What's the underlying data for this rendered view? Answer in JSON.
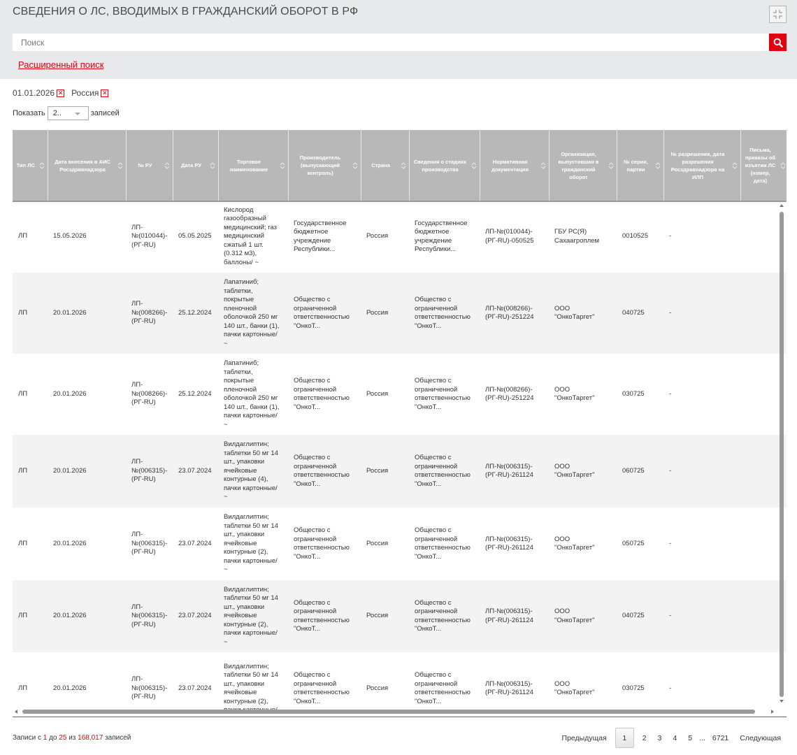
{
  "page": {
    "title": "СВЕДЕНИЯ О ЛС, ВВОДИМЫХ В ГРАЖДАНСКИЙ ОБОРОТ В РФ"
  },
  "search": {
    "placeholder": "Поиск",
    "advanced_label": "Расширенный поиск"
  },
  "filters": [
    {
      "label": "01.01.2026"
    },
    {
      "label": "Россия"
    }
  ],
  "length": {
    "prefix": "Показать",
    "value": "2..",
    "suffix": "записей"
  },
  "colors": {
    "accent": "#e3000f",
    "header_bg": "#b8b8b8"
  },
  "table": {
    "columns": [
      "Тип ЛС",
      "Дата внесения в АИС Росздравнадзора",
      "№ РУ",
      "Дата РУ",
      "Торговое наименование",
      "Производитель (выпускающий контроль)",
      "Страна",
      "Сведения о стадиях производства",
      "Нормативная документация",
      "Организация, выпустившая в гражданский оборот",
      "№ серии, партии",
      "№ разрешения, дата разрешения Росздравнадзора на ИЛП",
      "Письма, приказы об изъятии ЛС (номер, дата)"
    ],
    "rows": [
      [
        "ЛП",
        "15.05.2026",
        "ЛП-№(010044)-(РГ-RU)",
        "05.05.2025",
        "Кислород газообразный медицинский; газ медицинский сжатый 1 шт. (0.312 м3), баллоны/ ~",
        "Государственное бюджетное учреждение Республики...",
        "Россия",
        "Государственное бюджетное учреждение Республики...",
        "ЛП-№(010044)-(РГ-RU)-050525",
        "ГБУ РС(Я) Сахаагроплем",
        "0010525",
        "-",
        ""
      ],
      [
        "ЛП",
        "20.01.2026",
        "ЛП-№(008266)-(РГ-RU)",
        "25.12.2024",
        "Лапатиниб; таблетки, покрытые пленочной оболочкой 250 мг 140 шт., банки (1), пачки картонные/ ~",
        "Общество с ограниченной ответственностью \"ОнкоТ...",
        "Россия",
        "Общество с ограниченной ответственностью \"ОнкоТ...",
        "ЛП-№(008266)-(РГ-RU)-251224",
        "ООО \"ОнкоТаргет\"",
        "040725",
        "-",
        ""
      ],
      [
        "ЛП",
        "20.01.2026",
        "ЛП-№(008266)-(РГ-RU)",
        "25.12.2024",
        "Лапатиниб; таблетки, покрытые пленочной оболочкой 250 мг 140 шт., банки (1), пачки картонные/ ~",
        "Общество с ограниченной ответственностью \"ОнкоТ...",
        "Россия",
        "Общество с ограниченной ответственностью \"ОнкоТ...",
        "ЛП-№(008266)-(РГ-RU)-251224",
        "ООО \"ОнкоТаргет\"",
        "030725",
        "-",
        ""
      ],
      [
        "ЛП",
        "20.01.2026",
        "ЛП-№(006315)-(РГ-RU)",
        "23.07.2024",
        "Вилдаглиптин; таблетки 50 мг 14 шт., упаковки ячейковые контурные (4), пачки картонные/ ~",
        "Общество с ограниченной ответственностью \"ОнкоТ...",
        "Россия",
        "Общество с ограниченной ответственностью \"ОнкоТ...",
        "ЛП-№(006315)-(РГ-RU)-261124",
        "ООО \"ОнкоТаргет\"",
        "060725",
        "-",
        ""
      ],
      [
        "ЛП",
        "20.01.2026",
        "ЛП-№(006315)-(РГ-RU)",
        "23.07.2024",
        "Вилдаглиптин; таблетки 50 мг 14 шт., упаковки ячейковые контурные (2), пачки картонные/ ~",
        "Общество с ограниченной ответственностью \"ОнкоТ...",
        "Россия",
        "Общество с ограниченной ответственностью \"ОнкоТ...",
        "ЛП-№(006315)-(РГ-RU)-261124",
        "ООО \"ОнкоТаргет\"",
        "050725",
        "-",
        ""
      ],
      [
        "ЛП",
        "20.01.2026",
        "ЛП-№(006315)-(РГ-RU)",
        "23.07.2024",
        "Вилдаглиптин; таблетки 50 мг 14 шт., упаковки ячейковые контурные (2), пачки картонные/ ~",
        "Общество с ограниченной ответственностью \"ОнкоТ...",
        "Россия",
        "Общество с ограниченной ответственностью \"ОнкоТ...",
        "ЛП-№(006315)-(РГ-RU)-261124",
        "ООО \"ОнкоТаргет\"",
        "040725",
        "-",
        ""
      ],
      [
        "ЛП",
        "20.01.2026",
        "ЛП-№(006315)-(РГ-RU)",
        "23.07.2024",
        "Вилдаглиптин; таблетки 50 мг 14 шт., упаковки ячейковые контурные (2), пачки картонные/",
        "Общество с ограниченной ответственностью \"ОнкоТ...",
        "Россия",
        "Общество с ограниченной ответственностью \"ОнкоТ...",
        "ЛП-№(006315)-(РГ-RU)-261124",
        "ООО \"ОнкоТаргет\"",
        "030725",
        "-",
        ""
      ]
    ]
  },
  "info": {
    "prefix": "Записи с",
    "from": "1",
    "mid1": "до",
    "to": "25",
    "mid2": "из",
    "total": "168,017",
    "suffix": "записей"
  },
  "pager": {
    "prev": "Предыдущая",
    "current": "1",
    "pages": [
      "2",
      "3",
      "4",
      "5"
    ],
    "ellipsis": "...",
    "last": "6721",
    "next": "Следующая"
  }
}
